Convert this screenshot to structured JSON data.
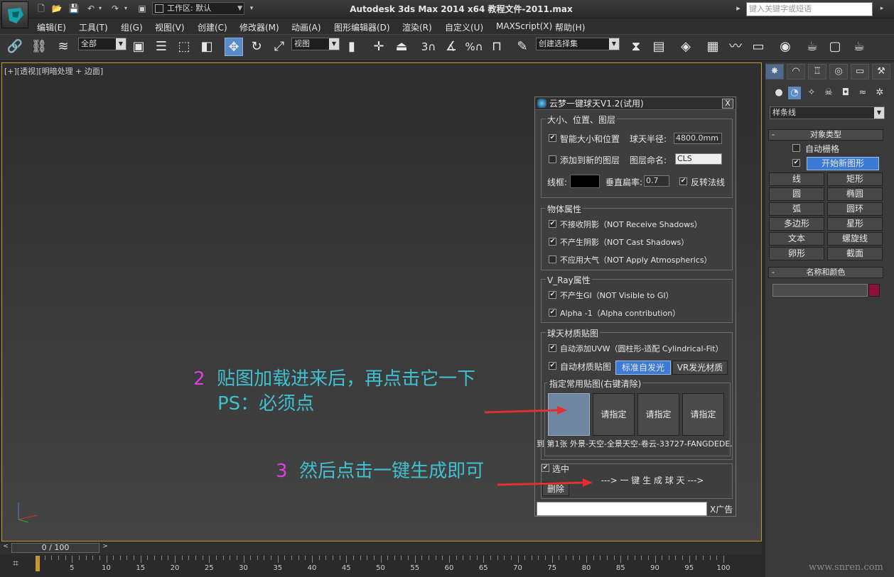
{
  "window": {
    "title": "Autodesk 3ds Max  2014 x64      教程文件-2011.max",
    "workspace_label": "工作区: 默认",
    "search_placeholder": "键入关键字或短语"
  },
  "menu": [
    "编辑(E)",
    "工具(T)",
    "组(G)",
    "视图(V)",
    "创建(C)",
    "修改器(M)",
    "动画(A)",
    "图形编辑器(D)",
    "渲染(R)",
    "自定义(U)",
    "MAXScript(X)",
    "帮助(H)"
  ],
  "toolbar": {
    "filter_value": "全部",
    "refcoord_value": "视图",
    "selection_set_value": "创建选择集",
    "snap_numbers": [
      "3",
      "%"
    ]
  },
  "viewport": {
    "label": "[+][透视][明暗处理 + 边面]"
  },
  "command_panel": {
    "category": "样条线",
    "object_type_header": "对象类型",
    "autogrid_label": "自动栅格",
    "start_new_shape": "开始新图形",
    "buttons": [
      "线",
      "矩形",
      "圆",
      "椭圆",
      "弧",
      "圆环",
      "多边形",
      "星形",
      "文本",
      "螺旋线",
      "卵形",
      "截面"
    ],
    "name_color_header": "名称和颜色",
    "colors": {
      "accent": "#3b7bd6",
      "object_color": "#8c1038"
    }
  },
  "dialog": {
    "title": "云梦一键球天V1.2(试用)",
    "close": "X",
    "group_size": {
      "title": "大小、位置、图层",
      "smart_size": "智能大小和位置",
      "radius_label": "球天半径:",
      "radius_value": "4800.0mm",
      "add_layer": "添加到新的图层",
      "layer_name_label": "图层命名:",
      "layer_name_value": "CLS",
      "wireframe_label": "线框:",
      "vertical_label": "垂直扁率:",
      "vertical_value": "0.7",
      "flip_normals": "反转法线"
    },
    "group_object": {
      "title": "物体属性",
      "items": [
        "不接收阴影（NOT Receive Shadows）",
        "不产生阴影（NOT Cast Shadows）",
        "不应用大气（NOT Apply Atmospherics）"
      ],
      "checked": [
        true,
        true,
        false
      ]
    },
    "group_vray": {
      "title": "V_Ray属性",
      "items": [
        "不产生GI（NOT Visible to GI）",
        "Alpha -1（Alpha contribution）"
      ],
      "checked": [
        true,
        true
      ]
    },
    "group_material": {
      "title": "球天材质贴图",
      "auto_uvw": "自动添加UVW（圆柱形-适配 Cylindrical-Fit）",
      "auto_material": "自动材质贴图",
      "std_emissive": "标准自发光",
      "vr_emissive": "VR发光材质",
      "slots_title": "指定常用贴图(右键清除)",
      "slots": [
        "",
        "请指定",
        "请指定",
        "请指定"
      ],
      "map_caption": "到 第1张 外景-天空-全景天空-卷云-33727-FANGDEDE."
    },
    "selected_label": "选中",
    "generate": "---> 一 键 生 成 球 天 --->",
    "delete": "删除",
    "ad": "X广告"
  },
  "annotations": {
    "step2_num": "2",
    "step2_text": "贴图加载进来后，再点击它一下",
    "step2_sub": "PS：必须点",
    "step3_num": "3",
    "step3_text": "然后点击一键生成即可"
  },
  "timeline": {
    "frame": "0 / 100",
    "ticks": [
      "5",
      "10",
      "15",
      "20",
      "25",
      "30",
      "35",
      "40",
      "45",
      "50",
      "55",
      "60",
      "65",
      "70",
      "75",
      "80",
      "85",
      "90",
      "95",
      "100"
    ]
  },
  "watermark": "www.snren.com"
}
